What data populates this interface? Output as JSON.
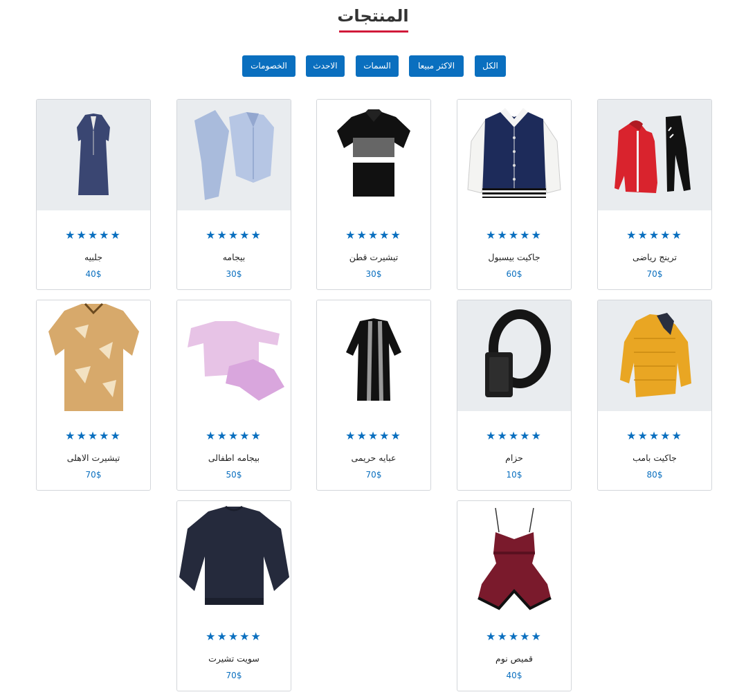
{
  "page": {
    "title": "المنتجات"
  },
  "filters": [
    {
      "label": "الكل"
    },
    {
      "label": "الاكثر مبيعا"
    },
    {
      "label": "السمات"
    },
    {
      "label": "الاحدث"
    },
    {
      "label": "الخصومات"
    }
  ],
  "colors": {
    "accent": "#0a6fbf",
    "title_underline": "#d1193a",
    "card_border": "#d3d6da",
    "image_bg": "#e9ecef"
  },
  "products": [
    {
      "name": "ترينج رياضى",
      "price": "70$",
      "rating": 5,
      "icon": "tracksuit-image"
    },
    {
      "name": "جاكيت بيسبول",
      "price": "60$",
      "rating": 5,
      "icon": "baseball-jacket-image"
    },
    {
      "name": "تيشيرت قطن",
      "price": "30$",
      "rating": 5,
      "icon": "polo-shirt-image"
    },
    {
      "name": "بيجامه",
      "price": "30$",
      "rating": 5,
      "icon": "pajama-image"
    },
    {
      "name": "جلبيه",
      "price": "40$",
      "rating": 5,
      "icon": "galabiya-image"
    },
    {
      "name": "جاكيت بامب",
      "price": "80$",
      "rating": 5,
      "icon": "puffer-jacket-image"
    },
    {
      "name": "حزام",
      "price": "10$",
      "rating": 5,
      "icon": "belt-image"
    },
    {
      "name": "عبايه حريمى",
      "price": "70$",
      "rating": 5,
      "icon": "abaya-image"
    },
    {
      "name": "بيجامه اطفالى",
      "price": "50$",
      "rating": 5,
      "icon": "kids-pajama-image"
    },
    {
      "name": "تيشيرت الاهلى",
      "price": "70$",
      "rating": 5,
      "icon": "football-shirt-image"
    },
    {
      "name": "قميص نوم",
      "price": "40$",
      "rating": 5,
      "icon": "nightwear-image"
    },
    {
      "name": "سويت تشيرت",
      "price": "70$",
      "rating": 5,
      "icon": "sweatshirt-image"
    }
  ],
  "stars_glyph": "★★★★★"
}
